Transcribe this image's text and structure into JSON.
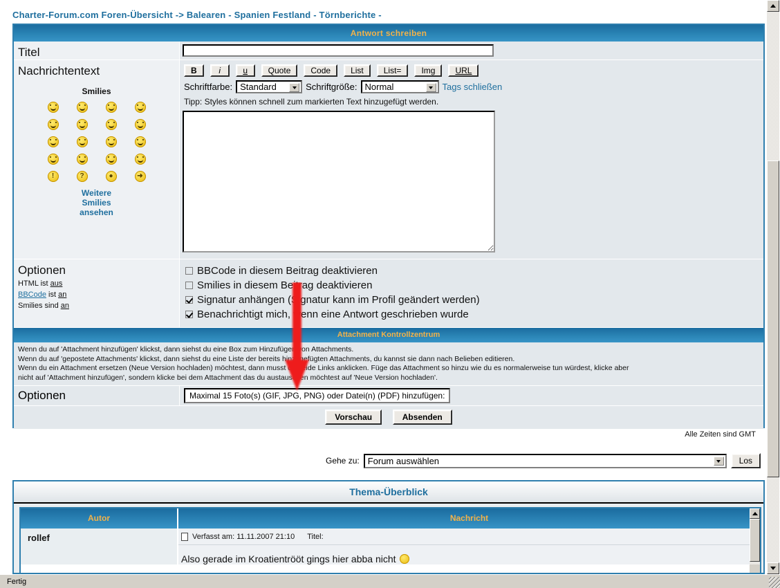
{
  "breadcrumb": "Charter-Forum.com Foren-Übersicht -> Balearen - Spanien Festland - Törnberichte -",
  "panel": {
    "header": "Antwort schreiben",
    "title_label": "Titel",
    "title_value": "",
    "message_label": "Nachrichtentext",
    "message_value": ""
  },
  "smilies": {
    "heading": "Smilies",
    "more_line1": "Weitere",
    "more_line2": "Smilies",
    "more_line3": "ansehen",
    "glyphs": [
      [
        "smiley-grin-icon",
        "smiley-big-grin-icon",
        "smiley-confused-icon",
        "smiley-happy-icon"
      ],
      [
        "smiley-surprised-icon",
        "smiley-neutral-icon",
        "smiley-cool-icon",
        "smiley-laugh-icon"
      ],
      [
        "smiley-sad-icon",
        "smiley-tongue-icon",
        "smiley-embarrassed-icon",
        "smiley-frown-icon"
      ],
      [
        "smiley-evil-icon",
        "smiley-twisted-icon",
        "smiley-rolleyes-icon",
        "smiley-wink-icon"
      ],
      [
        "smiley-exclaim-icon",
        "smiley-question-icon",
        "smiley-idea-icon",
        "smiley-arrow-icon"
      ]
    ],
    "chars": [
      [
        "☺",
        "☺",
        "☹",
        "☺"
      ],
      [
        "◉",
        "—",
        "▬",
        "△"
      ],
      [
        "⌒",
        "●",
        "○",
        "⌣"
      ],
      [
        "▲",
        "▲",
        "◎",
        "☺"
      ],
      [
        "!",
        "?",
        "◐",
        "➜"
      ]
    ]
  },
  "toolbar": {
    "buttons": [
      "B",
      "i",
      "u",
      "Quote",
      "Code",
      "List",
      "List=",
      "Img",
      "URL"
    ],
    "fontcolor_label": "Schriftfarbe:",
    "fontcolor_value": "Standard",
    "fontsize_label": "Schriftgröße:",
    "fontsize_value": "Normal",
    "close_tags": "Tags schließen",
    "tip": "Tipp: Styles können schnell zum markierten Text hinzugefügt werden."
  },
  "options": {
    "heading": "Optionen",
    "html_line": "HTML ist ",
    "html_state": "aus",
    "bbcode_link": "BBCode",
    "bbcode_mid": " ist ",
    "bbcode_state": "an",
    "smilies_line": "Smilies sind ",
    "smilies_state": "an",
    "checkboxes": [
      {
        "label": "BBCode in diesem Beitrag deaktivieren",
        "checked": false
      },
      {
        "label": "Smilies in diesem Beitrag deaktivieren",
        "checked": false
      },
      {
        "label": "Signatur anhängen (Signatur kann im Profil geändert werden)",
        "checked": true
      },
      {
        "label": "Benachrichtigt mich, wenn eine Antwort geschrieben wurde",
        "checked": true
      }
    ]
  },
  "attachment": {
    "header": "Attachment Kontrollzentrum",
    "lines": [
      "Wenn du auf 'Attachment hinzufügen' klickst, dann siehst du eine Box zum Hinzufügen von Attachments.",
      "Wenn du auf 'gepostete Attachments' klickst, dann siehst du eine Liste der bereits hinzugefügten Attachments, du kannst sie dann nach Belieben editieren.",
      "Wenn du ein Attachment ersetzen (Neue Version hochladen) möchtest, dann musst du beide Links anklicken. Füge das Attachment so hinzu wie du es normalerweise tun würdest, klicke aber",
      "nicht auf 'Attachment hinzufügen', sondern klicke bei dem Attachment das du austauschen möchtest auf 'Neue Version hochladen'."
    ],
    "options_label": "Optionen",
    "file_button": "Maximal 15 Foto(s) (GIF, JPG, PNG) oder Datei(n) (PDF) hinzufügen:"
  },
  "submit": {
    "preview": "Vorschau",
    "send": "Absenden"
  },
  "footer": {
    "gmt": "Alle Zeiten sind GMT",
    "goto_label": "Gehe zu:",
    "goto_value": "Forum auswählen",
    "go_button": "Los"
  },
  "thema": {
    "title": "Thema-Überblick",
    "col_author": "Autor",
    "col_message": "Nachricht",
    "rows": [
      {
        "author": "rollef",
        "posted": "Verfasst am: 11.11.2007 21:10",
        "title_label": "Titel:",
        "body": "Also gerade im Kroatientrööt gings hier abba nicht",
        "body_smiley": "smiley-rolleyes-icon"
      }
    ]
  },
  "status": {
    "text": "Fertig"
  },
  "colors": {
    "accent_blue": "#2f7fae",
    "header_orange": "#f2b24a",
    "link_blue": "#1f6f9e",
    "annotation_red": "#ee1c1c"
  }
}
